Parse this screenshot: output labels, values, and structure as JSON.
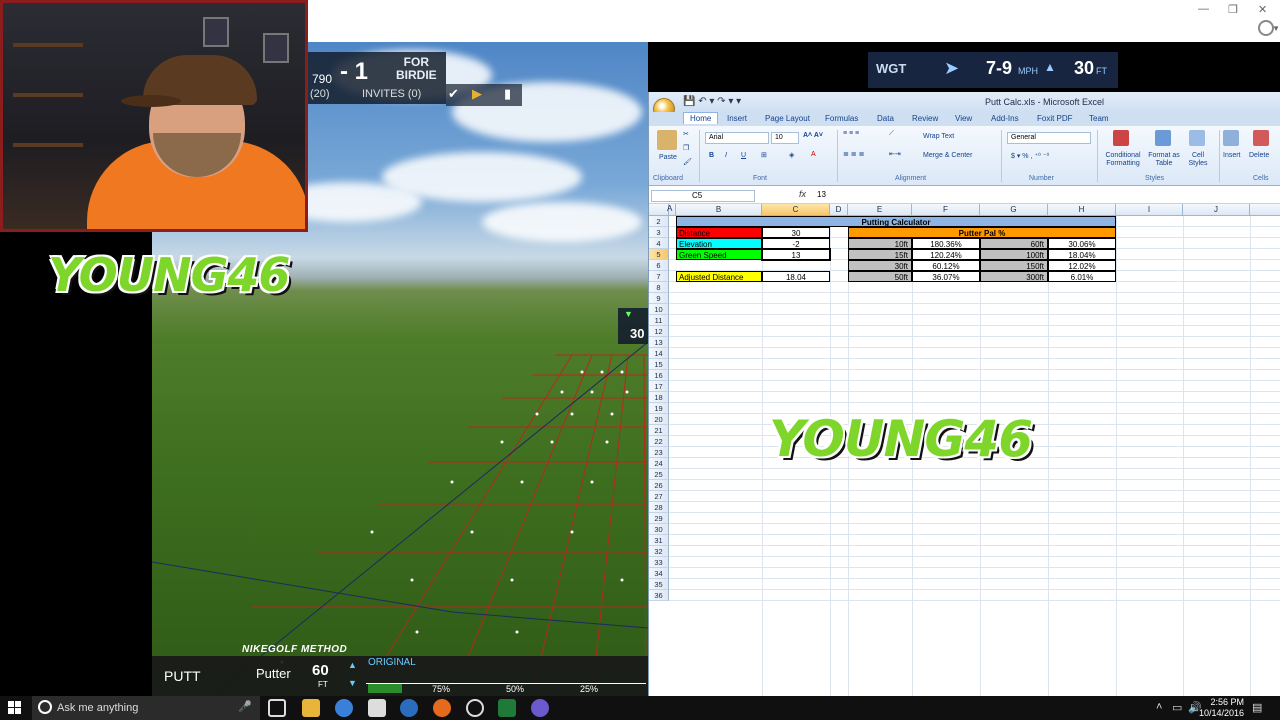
{
  "window": {
    "minimize": "—",
    "restore": "❐",
    "close": "✕"
  },
  "game": {
    "score_partial": "790",
    "score_delta": "- 1",
    "for_label": "FOR",
    "birdie_label": "BIRDIE",
    "strokes": "(20)",
    "invites": "INVITES (0)",
    "wind_brand": "WGT",
    "wind_speed": "7-9",
    "wind_unit": "MPH",
    "distance": "30",
    "distance_unit": "FT",
    "side_marker_value": "30",
    "shot_type": "PUTT",
    "club": "Putter",
    "club_distance": "60",
    "club_distance_unit": "FT",
    "mode": "ORIGINAL",
    "power_marks": [
      "75%",
      "50%",
      "25%"
    ],
    "sponsor": "NIKEGOLF METHOD"
  },
  "overlay": {
    "logo_left": "YOUNG46",
    "logo_center": "YOUNG46"
  },
  "excel": {
    "caption": "Putt Calc.xls - Microsoft Excel",
    "tabs": [
      "Home",
      "Insert",
      "Page Layout",
      "Formulas",
      "Data",
      "Review",
      "View",
      "Add-Ins",
      "Foxit PDF",
      "Team"
    ],
    "ribbon": {
      "paste": "Paste",
      "clipboard": "Clipboard",
      "font_name": "Arial",
      "font_size": "10",
      "font": "Font",
      "wrap_text": "Wrap Text",
      "merge_center": "Merge & Center",
      "alignment": "Alignment",
      "number_format": "General",
      "number": "Number",
      "conditional_formatting": "Conditional Formatting",
      "format_as_table": "Format as Table",
      "cell_styles": "Cell Styles",
      "styles": "Styles",
      "insert": "Insert",
      "delete": "Delete",
      "cells": "Cells"
    },
    "name_box": "C5",
    "formula_value": "13",
    "columns": [
      "A",
      "B",
      "C",
      "D",
      "E",
      "F",
      "G",
      "H",
      "I",
      "J"
    ],
    "rows": [
      "2",
      "3",
      "4",
      "5",
      "6",
      "7",
      "8",
      "9",
      "10",
      "11",
      "12",
      "13",
      "14",
      "15",
      "16",
      "17",
      "18",
      "19",
      "20",
      "21",
      "22",
      "23",
      "24",
      "25",
      "26",
      "27",
      "28",
      "29",
      "30",
      "31",
      "32",
      "33",
      "34",
      "35",
      "36"
    ],
    "calc": {
      "title": "Putting Calculator",
      "distance_label": "Distance",
      "distance_value": "30",
      "elevation_label": "Elevation",
      "elevation_value": "-2",
      "green_speed_label": "Green Speed",
      "green_speed_value": "13",
      "adjusted_label": "Adjusted Distance",
      "adjusted_value": "18.04",
      "putter_pal_title": "Putter Pal %",
      "pal_rows": [
        {
          "e": "10ft",
          "f": "180.36%",
          "g": "60ft",
          "h": "30.06%"
        },
        {
          "e": "15ft",
          "f": "120.24%",
          "g": "100ft",
          "h": "18.04%"
        },
        {
          "e": "30ft",
          "f": "60.12%",
          "g": "150ft",
          "h": "12.02%"
        },
        {
          "e": "50ft",
          "f": "36.07%",
          "g": "300ft",
          "h": "6.01%"
        }
      ]
    },
    "colors": {
      "title_fill": "#8db4e2",
      "distance_fill": "#ff0000",
      "elevation_fill": "#00ffff",
      "green_fill": "#00ff00",
      "adjusted_fill": "#ffff00",
      "pal_fill": "#ff9900",
      "grey_fill": "#c0c0c0"
    }
  },
  "taskbar": {
    "search_placeholder": "Ask me anything",
    "time": "2:56 PM",
    "date": "10/14/2016"
  }
}
